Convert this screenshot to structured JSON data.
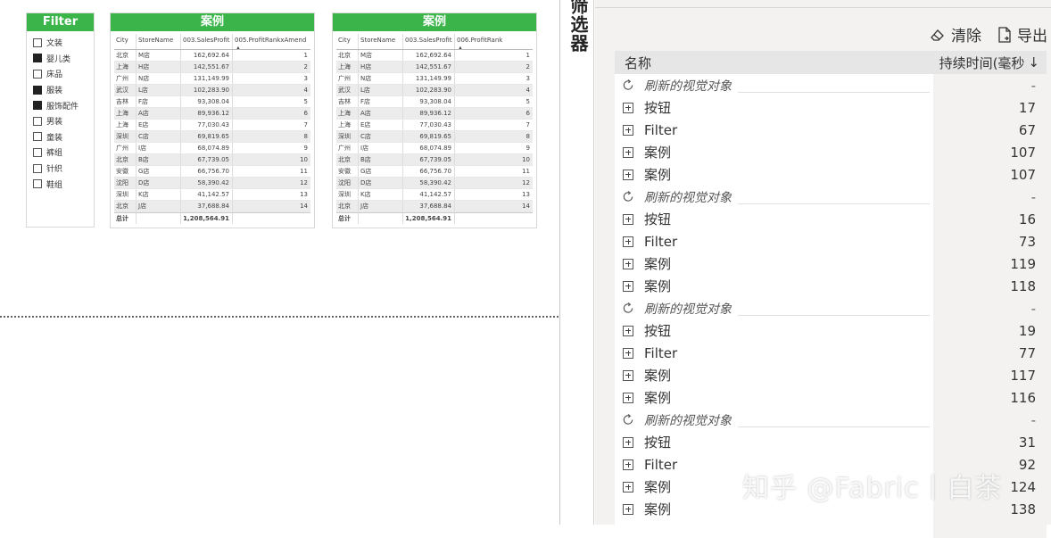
{
  "slicer": {
    "title": "Filter",
    "items": [
      {
        "label": "文装",
        "checked": false
      },
      {
        "label": "婴儿类",
        "checked": true
      },
      {
        "label": "床品",
        "checked": false
      },
      {
        "label": "服装",
        "checked": true
      },
      {
        "label": "服饰配件",
        "checked": true
      },
      {
        "label": "男装",
        "checked": false
      },
      {
        "label": "童装",
        "checked": false
      },
      {
        "label": "裤组",
        "checked": false
      },
      {
        "label": "针织",
        "checked": false
      },
      {
        "label": "鞋组",
        "checked": false
      }
    ]
  },
  "table1": {
    "title": "案例",
    "columns": [
      "City",
      "StoreName",
      "003.SalesProfit",
      "005.ProfitRankxAmend"
    ],
    "rows": [
      [
        "北京",
        "M店",
        "162,692.64",
        "1"
      ],
      [
        "上海",
        "H店",
        "142,551.67",
        "2"
      ],
      [
        "广州",
        "N店",
        "131,149.99",
        "3"
      ],
      [
        "武汉",
        "L店",
        "102,283.90",
        "4"
      ],
      [
        "吉林",
        "F店",
        "93,308.04",
        "5"
      ],
      [
        "上海",
        "A店",
        "89,936.12",
        "6"
      ],
      [
        "上海",
        "E店",
        "77,030.43",
        "7"
      ],
      [
        "深圳",
        "C店",
        "69,819.65",
        "8"
      ],
      [
        "广州",
        "I店",
        "68,074.89",
        "9"
      ],
      [
        "北京",
        "B店",
        "67,739.05",
        "10"
      ],
      [
        "安徽",
        "G店",
        "66,756.70",
        "11"
      ],
      [
        "沈阳",
        "D店",
        "58,390.42",
        "12"
      ],
      [
        "深圳",
        "K店",
        "41,142.57",
        "13"
      ],
      [
        "北京",
        "J店",
        "37,688.84",
        "14"
      ]
    ],
    "total": [
      "总计",
      "",
      "1,208,564.91",
      ""
    ]
  },
  "table2": {
    "title": "案例",
    "columns": [
      "City",
      "StoreName",
      "003.SalesProfit",
      "006.ProfitRank"
    ],
    "rows": [
      [
        "北京",
        "M店",
        "162,692.64",
        "1"
      ],
      [
        "上海",
        "H店",
        "142,551.67",
        "2"
      ],
      [
        "广州",
        "N店",
        "131,149.99",
        "3"
      ],
      [
        "武汉",
        "L店",
        "102,283.90",
        "4"
      ],
      [
        "吉林",
        "F店",
        "93,308.04",
        "5"
      ],
      [
        "上海",
        "A店",
        "89,936.12",
        "6"
      ],
      [
        "上海",
        "E店",
        "77,030.43",
        "7"
      ],
      [
        "深圳",
        "C店",
        "69,819.65",
        "8"
      ],
      [
        "广州",
        "I店",
        "68,074.89",
        "9"
      ],
      [
        "北京",
        "B店",
        "67,739.05",
        "10"
      ],
      [
        "安徽",
        "G店",
        "66,756.70",
        "11"
      ],
      [
        "沈阳",
        "D店",
        "58,390.42",
        "12"
      ],
      [
        "深圳",
        "K店",
        "41,142.57",
        "13"
      ],
      [
        "北京",
        "J店",
        "37,688.84",
        "14"
      ]
    ],
    "total": [
      "总计",
      "",
      "1,208,564.91",
      ""
    ]
  },
  "side_title": "筛选器",
  "analyzer": {
    "clear_label": "清除",
    "export_label": "导出",
    "col_name": "名称",
    "col_duration": "持续时间(毫秒",
    "rows": [
      {
        "type": "refresh",
        "label": "刷新的视觉对象",
        "duration": "-"
      },
      {
        "type": "item",
        "label": "按钮",
        "duration": "17"
      },
      {
        "type": "item",
        "label": "Filter",
        "duration": "67"
      },
      {
        "type": "item",
        "label": "案例",
        "duration": "107"
      },
      {
        "type": "item",
        "label": "案例",
        "duration": "107"
      },
      {
        "type": "refresh",
        "label": "刷新的视觉对象",
        "duration": "-"
      },
      {
        "type": "item",
        "label": "按钮",
        "duration": "16"
      },
      {
        "type": "item",
        "label": "Filter",
        "duration": "73"
      },
      {
        "type": "item",
        "label": "案例",
        "duration": "119"
      },
      {
        "type": "item",
        "label": "案例",
        "duration": "118"
      },
      {
        "type": "refresh",
        "label": "刷新的视觉对象",
        "duration": "-"
      },
      {
        "type": "item",
        "label": "按钮",
        "duration": "19"
      },
      {
        "type": "item",
        "label": "Filter",
        "duration": "77"
      },
      {
        "type": "item",
        "label": "案例",
        "duration": "117"
      },
      {
        "type": "item",
        "label": "案例",
        "duration": "116"
      },
      {
        "type": "refresh",
        "label": "刷新的视觉对象",
        "duration": "-"
      },
      {
        "type": "item",
        "label": "按钮",
        "duration": "31"
      },
      {
        "type": "item",
        "label": "Filter",
        "duration": "92"
      },
      {
        "type": "item",
        "label": "案例",
        "duration": "124"
      },
      {
        "type": "item",
        "label": "案例",
        "duration": "138"
      }
    ]
  },
  "watermark": "知乎 @Fabric丨白茶",
  "colors": {
    "accent_green": "#3bb54a",
    "pane_bg": "#f3f2f1"
  }
}
